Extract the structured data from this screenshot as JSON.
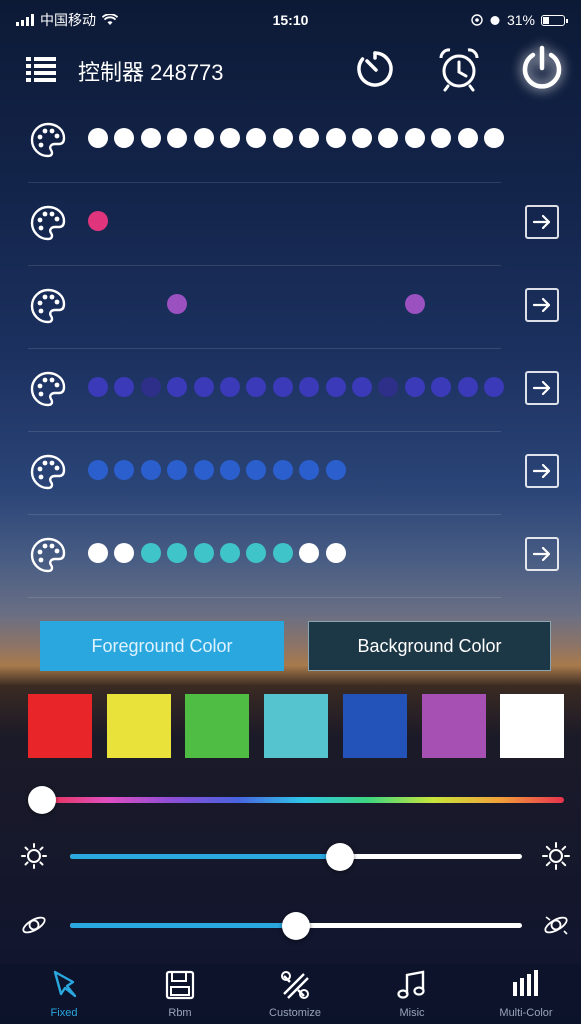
{
  "status_bar": {
    "carrier": "中国移动",
    "time": "15:10",
    "battery": "31%"
  },
  "header": {
    "title": "控制器 248773",
    "icons": [
      "menu-icon",
      "timer-icon",
      "alarm-icon",
      "power-icon"
    ]
  },
  "pattern_rows": [
    {
      "dots": [
        "#ffffff",
        "#ffffff",
        "#ffffff",
        "#ffffff",
        "#ffffff",
        "#ffffff",
        "#ffffff",
        "#ffffff",
        "#ffffff",
        "#ffffff",
        "#ffffff",
        "#ffffff",
        "#ffffff",
        "#ffffff",
        "#ffffff",
        "#ffffff"
      ],
      "dot_slots": [
        0,
        1,
        2,
        3,
        4,
        5,
        6,
        7,
        8,
        9,
        10,
        11,
        12,
        13,
        14,
        15
      ],
      "has_arrow": false
    },
    {
      "dots": [
        "#e0357d"
      ],
      "dot_slots": [
        0
      ],
      "has_arrow": true
    },
    {
      "dots": [
        "#9b52c0",
        "#9b52c0"
      ],
      "dot_slots": [
        3,
        12
      ],
      "has_arrow": true
    },
    {
      "dots": [
        "#3b3ab8",
        "#3b3ab8",
        "#2e2f88",
        "#3b3ab8",
        "#3b3ab8",
        "#3b3ab8",
        "#3b3ab8",
        "#3b3ab8",
        "#3b3ab8",
        "#3b3ab8",
        "#3b3ab8",
        "#2e2f88",
        "#3b3ab8",
        "#3b3ab8",
        "#3b3ab8",
        "#3b3ab8"
      ],
      "dot_slots": [
        0,
        1,
        2,
        3,
        4,
        5,
        6,
        7,
        8,
        9,
        10,
        11,
        12,
        13,
        14,
        15
      ],
      "has_arrow": true
    },
    {
      "dots": [
        "#2b5fce",
        "#2b5fce",
        "#2b5fce",
        "#2b5fce",
        "#2b5fce",
        "#2b5fce",
        "#2b5fce",
        "#2b5fce",
        "#2b5fce",
        "#2b5fce"
      ],
      "dot_slots": [
        0,
        1,
        2,
        3,
        4,
        5,
        6,
        7,
        8,
        9
      ],
      "has_arrow": true
    },
    {
      "dots": [
        "#ffffff",
        "#ffffff",
        "#3fc5c9",
        "#3fc5c9",
        "#3fc5c9",
        "#3fc5c9",
        "#3fc5c9",
        "#3fc5c9",
        "#ffffff",
        "#ffffff"
      ],
      "dot_slots": [
        0,
        1,
        2,
        3,
        4,
        5,
        6,
        7,
        8,
        9
      ],
      "has_arrow": true
    }
  ],
  "color_tabs": {
    "foreground": "Foreground Color",
    "background": "Background Color",
    "selected": "foreground"
  },
  "swatches": [
    "#e8262a",
    "#e8e23a",
    "#4fbd44",
    "#55c4cf",
    "#2353b9",
    "#a650b4",
    "#ffffff"
  ],
  "hue_slider": {
    "value": 0.0
  },
  "brightness_slider": {
    "value": 0.597
  },
  "speed_slider": {
    "value": 0.5
  },
  "tabs": [
    {
      "label": "Fixed",
      "icon": "pin-icon",
      "active": true
    },
    {
      "label": "Rbm",
      "icon": "save-icon",
      "active": false
    },
    {
      "label": "Customize",
      "icon": "tools-icon",
      "active": false
    },
    {
      "label": "Misic",
      "icon": "music-icon",
      "active": false
    },
    {
      "label": "Multi-Color",
      "icon": "bars-icon",
      "active": false
    }
  ]
}
